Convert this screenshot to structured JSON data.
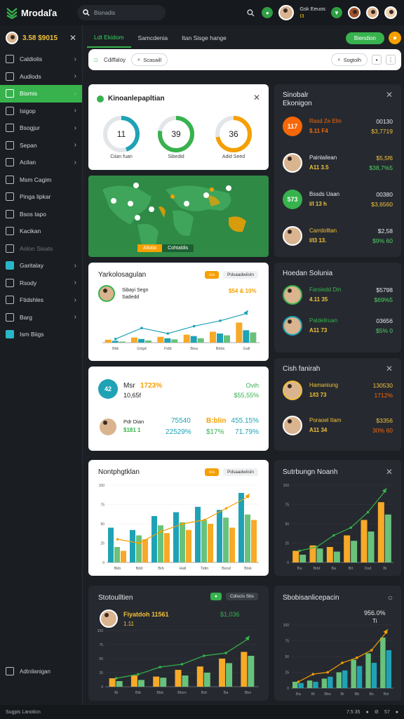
{
  "app": {
    "title": "Mrodaľa"
  },
  "search": {
    "placeholder": "Bisnadis"
  },
  "user": {
    "name": "Gsk Eeuos",
    "sub": "I3"
  },
  "sidebar": {
    "balance": "3.58 $9015",
    "items": [
      {
        "label": "Caldiolis",
        "chev": true
      },
      {
        "label": "Audlods",
        "chev": true
      },
      {
        "label": "Bismis",
        "chev": true,
        "active": true
      },
      {
        "label": "Isigop",
        "chev": true
      },
      {
        "label": "Bsogjur",
        "chev": true
      },
      {
        "label": "Sepan",
        "chev": true
      },
      {
        "label": "Acilan",
        "chev": true
      },
      {
        "label": "Msm Cagim",
        "chev": false
      },
      {
        "label": "Pinga lipkar",
        "chev": false
      },
      {
        "label": "Bsos tapo",
        "chev": false
      },
      {
        "label": "Kacikan",
        "chev": false
      },
      {
        "label": "Aolon Sisats",
        "chev": false,
        "dim": true
      },
      {
        "label": "Garitalay",
        "chev": true
      },
      {
        "label": "Rsody",
        "chev": true
      },
      {
        "label": "Ftidshles",
        "chev": true
      },
      {
        "label": "Barg",
        "chev": true
      },
      {
        "label": "Ism Biigs",
        "chev": false
      }
    ],
    "footer": "Adtnilanigan"
  },
  "tabs": [
    "Ldt Ekidom",
    "Samcdenia",
    "Itan Sisge hange"
  ],
  "tab_button": "Biendion",
  "filterbar": {
    "item1": "Cdiffaloy",
    "item2": "Scasaill",
    "right_pill": "Sogtolh"
  },
  "kpi_card": {
    "title": "Kinoanlepapltian",
    "donuts": [
      {
        "value": "11",
        "label": "Ciian fuan",
        "pct": 0.45,
        "color": "#1fa2b5"
      },
      {
        "value": "39",
        "label": "Sibedid",
        "pct": 0.78,
        "color": "#37b24d"
      },
      {
        "value": "36",
        "label": "Adid Seed",
        "pct": 0.72,
        "color": "#f59f00"
      }
    ]
  },
  "map_legend": {
    "a": "Ailutia",
    "b": "Cohtaldis"
  },
  "right_top": {
    "title": "Sinobalr\nEkonigon",
    "rows": [
      {
        "badge": "117",
        "name": "Rasd Ze Elin",
        "sub": "$.11 F4",
        "val1": "00130",
        "val2": "$3,7719",
        "badge_color": "#f76707",
        "name_color": "#f76707",
        "sub_color": "#f76707",
        "val2_color": "#f3c13a"
      },
      {
        "name": "Painlailean",
        "sub": "A11 3.5",
        "val1": "$5,5f6",
        "val2": "$38,7%5",
        "name_color": "#e6e8eb",
        "sub_color": "#f3c13a",
        "val1_color": "#f3c13a",
        "val2_color": "#51cf66"
      },
      {
        "badge": "573",
        "name": "Bssds Uaan",
        "sub": "I/I 13 h",
        "val1": "00380",
        "val2": "$3,6560",
        "badge_color": "#37b24d",
        "name_color": "#e6e8eb",
        "sub_color": "#f3c13a",
        "val2_color": "#f3c13a"
      },
      {
        "name": "Carrdolltan",
        "sub": "I/I3 13.",
        "val1": "$2,58",
        "val2": "$9% 60",
        "name_color": "#f3c13a",
        "sub_color": "#f3c13a",
        "val2_color": "#51cf66"
      }
    ]
  },
  "chart1": {
    "title": "Yarkolosagulan",
    "tag1": "iss",
    "tag2": "Pdsaadwiisln",
    "person": "Sibayi Segn",
    "person_sub": "Sadedd",
    "metric": "$54 & 10%",
    "categories": [
      "Bitk",
      "Gdgd",
      "Fidb",
      "Bisa",
      "Bdds",
      "Gall"
    ]
  },
  "chart_data": [
    {
      "type": "bar",
      "categories": [
        "Bitk",
        "Gdgd",
        "Fidb",
        "Bisa",
        "Bdds",
        "Gall"
      ],
      "series": [
        {
          "values": [
            8,
            14,
            16,
            22,
            30,
            55
          ],
          "color": "#f7a928"
        },
        {
          "values": [
            5,
            10,
            12,
            18,
            25,
            34
          ],
          "color": "#1fa2b5"
        },
        {
          "values": [
            3,
            6,
            9,
            12,
            20,
            28
          ],
          "color": "#69c27b"
        }
      ],
      "line": [
        10,
        40,
        25,
        45,
        60,
        80
      ]
    },
    {
      "type": "bar",
      "categories": [
        "Bkb",
        "Bdd",
        "Brb",
        "Hatl",
        "Tidin",
        "Bsnd",
        "Btsk"
      ],
      "series": [
        {
          "values": [
            45,
            42,
            60,
            65,
            72,
            68,
            90
          ],
          "color": "#1fa2b5"
        },
        {
          "values": [
            20,
            35,
            48,
            52,
            55,
            58,
            62
          ],
          "color": "#69c27b"
        },
        {
          "values": [
            15,
            30,
            38,
            42,
            50,
            45,
            55
          ],
          "color": "#f7a928"
        }
      ],
      "line": [
        30,
        25,
        40,
        50,
        55,
        70,
        85
      ]
    },
    {
      "type": "bar",
      "categories": [
        "Ba",
        "Bdd",
        "Ba",
        "Brt",
        "Dsd",
        "Bi"
      ],
      "series": [
        {
          "values": [
            15,
            22,
            20,
            35,
            55,
            78
          ],
          "color": "#f7a928"
        },
        {
          "values": [
            10,
            18,
            14,
            28,
            40,
            62
          ],
          "color": "#69c27b"
        }
      ],
      "line": [
        15,
        20,
        35,
        45,
        65,
        92
      ]
    },
    {
      "type": "bar",
      "categories": [
        "Bi",
        "Bib",
        "Bbb",
        "Btsm",
        "Bid",
        "Ba",
        "Bbs"
      ],
      "series": [
        {
          "values": [
            15,
            20,
            18,
            30,
            36,
            50,
            62
          ],
          "color": "#f7a928"
        },
        {
          "values": [
            10,
            12,
            16,
            20,
            25,
            42,
            55
          ],
          "color": "#69c27b"
        }
      ],
      "line": [
        15,
        22,
        35,
        40,
        55,
        60,
        85
      ]
    },
    {
      "type": "bar",
      "categories": [
        "Ba",
        "Bi",
        "Bbs",
        "Bi",
        "Bb",
        "Bs",
        "Bsl"
      ],
      "series": [
        {
          "values": [
            10,
            12,
            15,
            25,
            45,
            55,
            80
          ],
          "color": "#69c27b"
        },
        {
          "values": [
            8,
            10,
            18,
            28,
            35,
            40,
            60
          ],
          "color": "#1fa2b5"
        }
      ],
      "line": [
        10,
        22,
        25,
        40,
        48,
        60,
        88
      ]
    }
  ],
  "stats_card": {
    "badge": "42",
    "label": "Msr",
    "metric": "1723%",
    "sub": "10,65f",
    "right_label": "Ovih",
    "right_val": "$55,55%",
    "person": "Pdr Dian",
    "person_sub": "$181 1",
    "c1a": "75540",
    "c1b": "22529%",
    "c2a": "B:blin",
    "c2b": "$17%",
    "c3a": "455.15%",
    "c3b": "71.79%"
  },
  "right_mid": {
    "title": "Hoedan Solunia",
    "rows": [
      {
        "name": "Farsiedd Din",
        "sub": "4.11 35",
        "val1": "$5798",
        "val2": "$69%5"
      },
      {
        "name": "Paldeliruan",
        "sub": "A11 73",
        "val1": "03656",
        "val2": "$5% 0"
      }
    ]
  },
  "cash_card": {
    "title": "Cish fanirah",
    "rows": [
      {
        "name": "Hamaniung",
        "sub": "1/I3 73",
        "val1": "130530",
        "val2": "1712%"
      },
      {
        "name": "Poraoel Itam",
        "sub": "A11 34",
        "val1": "$3356",
        "val2": "30% 60"
      }
    ]
  },
  "chart2": {
    "title": "Nontphgtklan",
    "tag1": "iss",
    "tag2": "Pdsaadwiisln"
  },
  "chart3": {
    "title": "Sutrbungn Noanh"
  },
  "chart4": {
    "title": "Stotoulltien",
    "tag1": "Cdiscis Sbs",
    "metric": "Fiyatdoh 11561",
    "value": "$1,036",
    "sub": "1.11"
  },
  "chart5": {
    "title": "Sbobisanlicepacin",
    "value": "956.0%",
    "sub": "Ti"
  },
  "status": {
    "left": "Sugpis Lanoticn",
    "right": "7.5 35"
  }
}
